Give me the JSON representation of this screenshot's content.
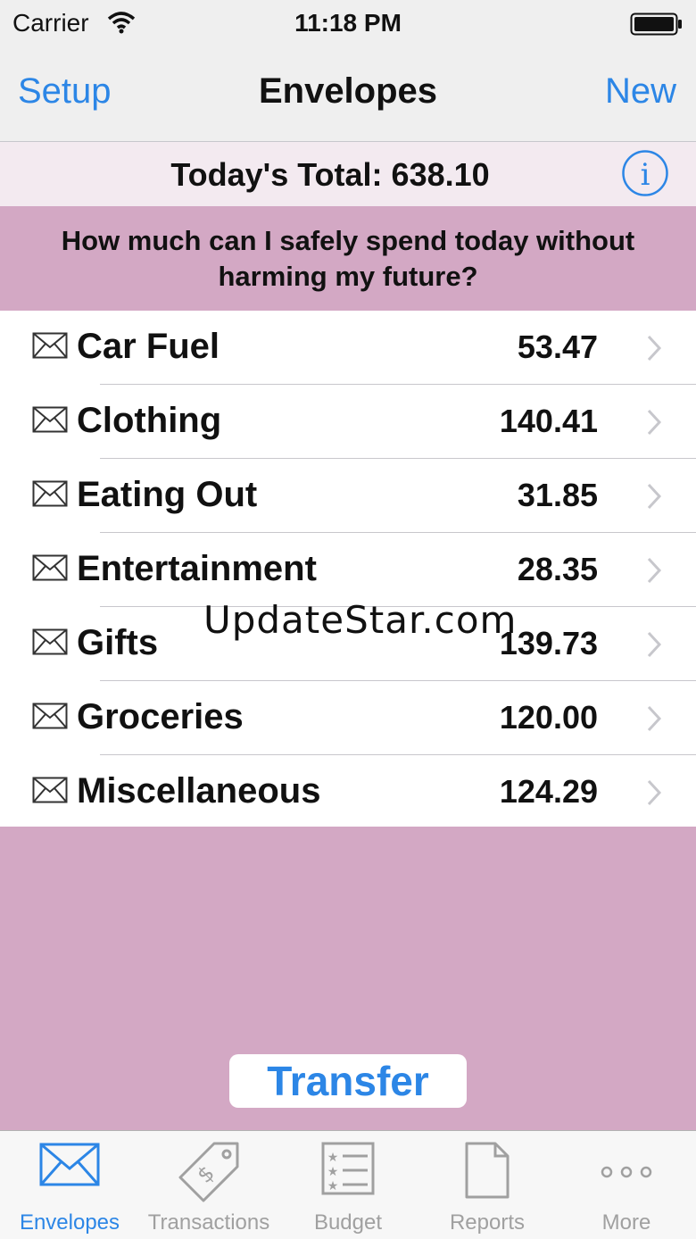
{
  "status": {
    "carrier": "Carrier",
    "time": "11:18 PM"
  },
  "nav": {
    "left": "Setup",
    "title": "Envelopes",
    "right": "New"
  },
  "total": {
    "label": "Today's Total:  638.10"
  },
  "question": "How much can I safely spend today without harming my future?",
  "envelopes": [
    {
      "name": "Car Fuel",
      "amount": "53.47"
    },
    {
      "name": "Clothing",
      "amount": "140.41"
    },
    {
      "name": "Eating Out",
      "amount": "31.85"
    },
    {
      "name": "Entertainment",
      "amount": "28.35"
    },
    {
      "name": "Gifts",
      "amount": "139.73"
    },
    {
      "name": "Groceries",
      "amount": "120.00"
    },
    {
      "name": "Miscellaneous",
      "amount": "124.29"
    }
  ],
  "watermark": "UpdateStar.com",
  "transfer": "Transfer",
  "tabs": [
    {
      "label": "Envelopes",
      "icon": "envelope-icon",
      "active": true
    },
    {
      "label": "Transactions",
      "icon": "tag-icon",
      "active": false
    },
    {
      "label": "Budget",
      "icon": "list-icon",
      "active": false
    },
    {
      "label": "Reports",
      "icon": "document-icon",
      "active": false
    },
    {
      "label": "More",
      "icon": "more-icon",
      "active": false
    }
  ],
  "colors": {
    "accent": "#2c86e6",
    "background": "#d3a8c4",
    "tab_inactive": "#a0a0a0"
  }
}
